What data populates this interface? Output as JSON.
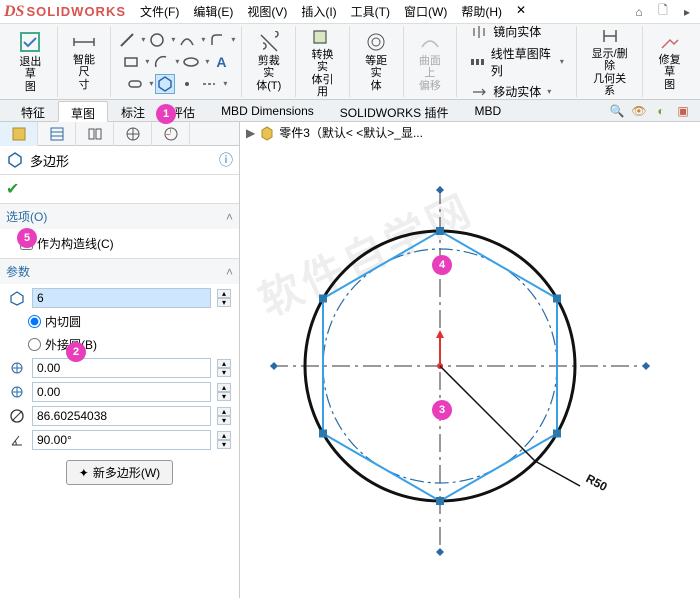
{
  "logo": {
    "ds": "DS",
    "text": "SOLIDWORKS"
  },
  "menu": [
    "文件(F)",
    "编辑(E)",
    "视图(V)",
    "插入(I)",
    "工具(T)",
    "窗口(W)",
    "帮助(H)"
  ],
  "ribbon": {
    "exit_sketch": "退出草\n图",
    "smart_dim": "智能尺\n寸",
    "trim": "剪裁实\n体(T)",
    "convert": "转换实\n体引用",
    "offset": "等距实\n体",
    "surface_offset": "曲面上\n偏移",
    "mirror": "镜向实体",
    "linear_pattern": "线性草图阵列",
    "move": "移动实体",
    "show_relations": "显示/删除\n几何关系",
    "repair": "修复草\n图"
  },
  "tabs": [
    "特征",
    "草图",
    "标注",
    "评估",
    "MBD Dimensions",
    "SOLIDWORKS 插件",
    "MBD"
  ],
  "active_tab": "草图",
  "crumb": "零件3（默认< <默认>_显...",
  "pm": {
    "title": "多边形",
    "options_h": "选项(O)",
    "construction": "作为构造线(C)",
    "params_h": "参数",
    "sides": "6",
    "inscribed": "内切圆",
    "circumscribed": "外接圆(B)",
    "cx": "0.00",
    "cy": "0.00",
    "diameter": "86.60254038",
    "angle": "90.00°",
    "new_poly": "新多边形(W)"
  },
  "dimension": "R50",
  "badges": {
    "b1": "1",
    "b2": "2",
    "b3": "3",
    "b4": "4",
    "b5": "5"
  },
  "chart_data": {
    "type": "diagram",
    "shapes": [
      {
        "kind": "circle",
        "cx": 0,
        "cy": 0,
        "r": 50,
        "style": "construction-circle-outer"
      },
      {
        "kind": "circle",
        "cx": 0,
        "cy": 0,
        "r": 43.3,
        "style": "inscribed-circle"
      },
      {
        "kind": "polygon",
        "sides": 6,
        "cx": 0,
        "cy": 0,
        "inscribed_r": 43.3,
        "rotation_deg": 90
      }
    ],
    "axes": {
      "centerlines": true
    },
    "dimension": {
      "label": "R50",
      "from": "center",
      "to": "circle-outer"
    }
  }
}
